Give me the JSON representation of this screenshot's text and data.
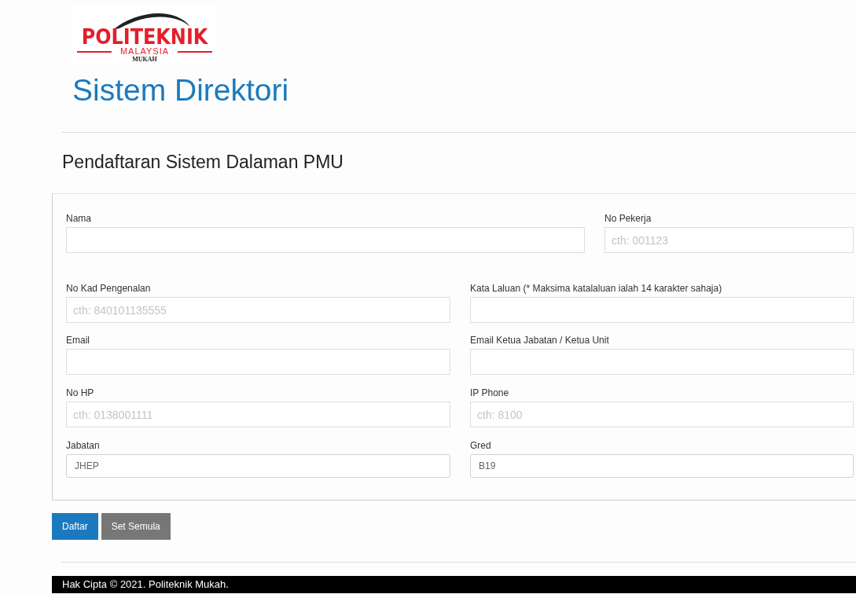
{
  "logo": {
    "name": "POLITEKNIK",
    "country": "MALAYSIA",
    "campus": "MUKAH"
  },
  "title": "Sistem Direktori",
  "heading": "Pendaftaran Sistem Dalaman PMU",
  "form_rows": [
    [
      {
        "label": "Nama",
        "kind": "text"
      },
      {
        "label": "No Pekerja",
        "kind": "text",
        "placeholder": "cth: 001123"
      }
    ],
    [
      {
        "label": "No Kad Pengenalan",
        "kind": "text",
        "placeholder": "cth: 840101135555"
      },
      {
        "label": "Kata Laluan (* Maksima katalaluan ialah 14 karakter sahaja)",
        "kind": "text"
      }
    ],
    [
      {
        "label": "Email",
        "kind": "text"
      },
      {
        "label": "Email Ketua Jabatan / Ketua Unit",
        "kind": "text"
      }
    ],
    [
      {
        "label": "No HP",
        "kind": "text",
        "placeholder": "cth: 0138001111"
      },
      {
        "label": "IP Phone",
        "kind": "text",
        "placeholder": "cth: 8100"
      }
    ],
    [
      {
        "label": "Jabatan",
        "kind": "select",
        "value": "JHEP"
      },
      {
        "label": "Gred",
        "kind": "select",
        "value": "B19"
      }
    ]
  ],
  "buttons": [
    {
      "label": "Daftar",
      "kind": "primary"
    },
    {
      "label": "Set Semula",
      "kind": "secondary"
    }
  ],
  "footer": "Hak Cipta © 2021. Politeknik Mukah."
}
